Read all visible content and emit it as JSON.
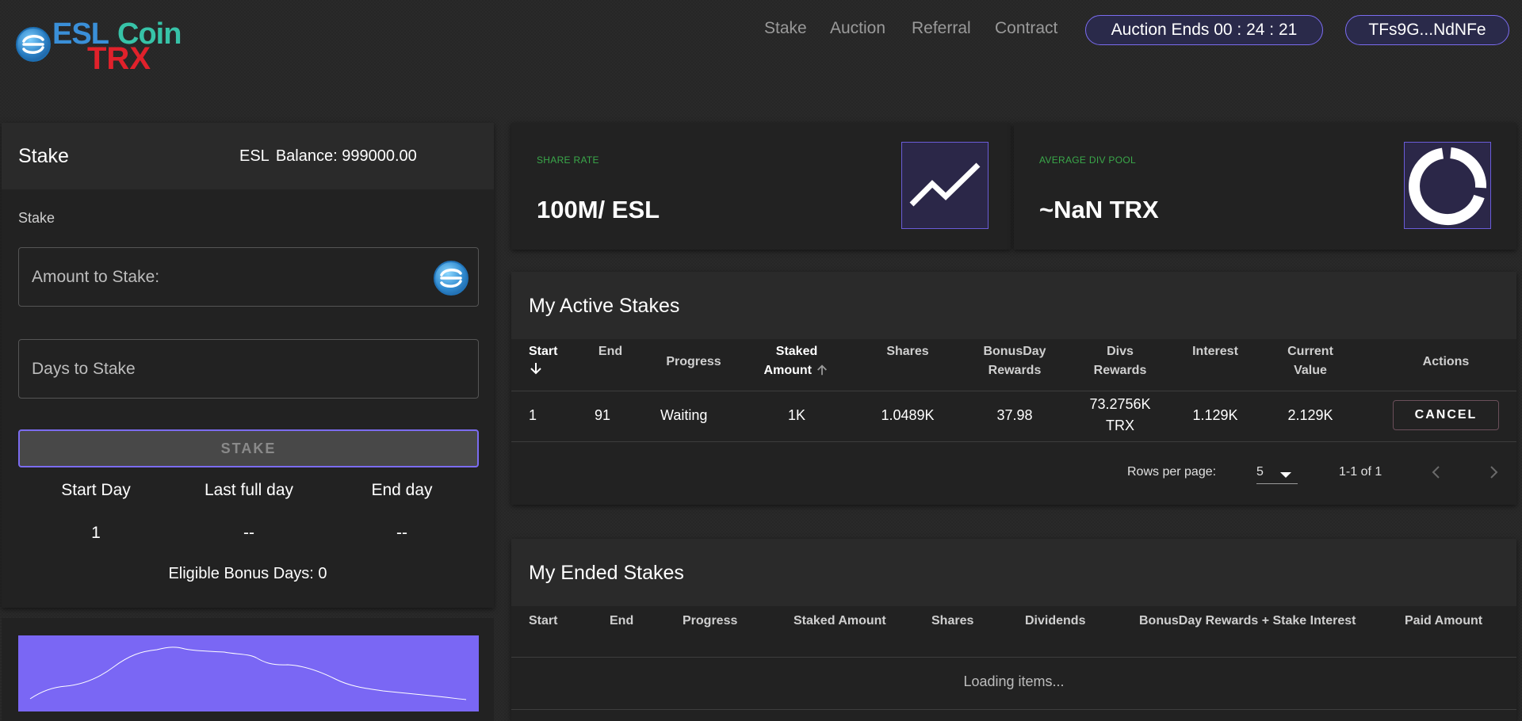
{
  "brand": {
    "esl": "ESL",
    "coin": "Coin",
    "trx": "TRX"
  },
  "nav": {
    "items": [
      "Stake",
      "Auction",
      "Referral",
      "Contract"
    ],
    "auction_timer": "Auction Ends 00 : 24 : 21",
    "wallet": "TFs9G...NdNFe"
  },
  "stake_panel": {
    "title": "Stake",
    "balance_token": "ESL",
    "balance_text": "Balance: 999000.00",
    "section_label": "Stake",
    "amount_placeholder": "Amount to Stake:",
    "days_placeholder": "Days to Stake",
    "stake_button": "STAKE",
    "start_day_label": "Start Day",
    "start_day_value": "1",
    "last_full_day_label": "Last full day",
    "last_full_day_value": "--",
    "end_day_label": "End day",
    "end_day_value": "--",
    "bonus_days": "Eligible Bonus Days: 0"
  },
  "stats": {
    "share_rate_label": "SHARE RATE",
    "share_rate_value": "100M/ ESL",
    "avg_div_label": "AVERAGE DIV POOL",
    "avg_div_value": "~NaN TRX"
  },
  "active_stakes": {
    "title": "My Active Stakes",
    "headers": {
      "start": "Start",
      "end": "End",
      "progress": "Progress",
      "staked_1": "Staked",
      "staked_2": "Amount",
      "shares": "Shares",
      "bonus_1": "BonusDay",
      "bonus_2": "Rewards",
      "divs_1": "Divs",
      "divs_2": "Rewards",
      "interest": "Interest",
      "current_1": "Current",
      "current_2": "Value",
      "actions": "Actions"
    },
    "rows": [
      {
        "start": "1",
        "end": "91",
        "progress": "Waiting",
        "staked": "1K",
        "shares": "1.0489K",
        "bonus": "37.98",
        "divs_1": "73.2756K",
        "divs_2": "TRX",
        "interest": "1.129K",
        "current": "2.129K",
        "action": "CANCEL"
      }
    ],
    "rows_per_page_label": "Rows per page:",
    "rows_per_page_value": "5",
    "page_info": "1-1 of 1"
  },
  "ended_stakes": {
    "title": "My Ended Stakes",
    "headers": {
      "start": "Start",
      "end": "End",
      "progress": "Progress",
      "staked": "Staked Amount",
      "shares": "Shares",
      "dividends": "Dividends",
      "bonus_interest": "BonusDay Rewards + Stake Interest",
      "paid": "Paid Amount"
    },
    "loading_text": "Loading items..."
  },
  "colors": {
    "accent": "#7b6cf0",
    "chart_fill": "#7a67f4",
    "stat_label": "#3aa84a",
    "logo_esl": "#3a8fd8",
    "logo_coin": "#37c3a8",
    "logo_trx": "#e0212b"
  },
  "icons": {
    "share_rate": "trending-up-icon",
    "avg_div": "donut-chart-icon",
    "sort_down": "arrow-down-icon",
    "sort_up": "arrow-up-icon",
    "select": "caret-down-icon",
    "prev": "chevron-left-icon",
    "next": "chevron-right-icon"
  }
}
